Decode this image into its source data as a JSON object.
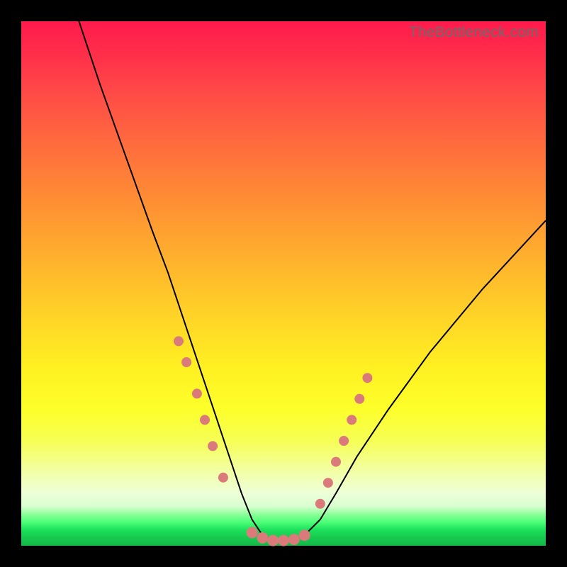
{
  "watermark": "TheBottleneck.com",
  "chart_data": {
    "type": "line",
    "title": "",
    "xlabel": "",
    "ylabel": "",
    "xlim": [
      0,
      100
    ],
    "ylim": [
      0,
      100
    ],
    "grid": false,
    "series": [
      {
        "name": "curve",
        "x": [
          11,
          15,
          20,
          25,
          28,
          30,
          32,
          34,
          36,
          38,
          40,
          42,
          44,
          46,
          48,
          50,
          52,
          54,
          57,
          60,
          64,
          70,
          78,
          88,
          100
        ],
        "y": [
          100,
          88,
          74,
          60,
          52,
          46,
          40,
          34,
          28,
          22,
          16,
          10,
          5,
          2,
          1,
          1,
          1,
          2,
          5,
          10,
          17,
          26,
          37,
          49,
          62
        ],
        "stroke": "#000000",
        "stroke_width": 2
      }
    ],
    "markers": [
      {
        "cluster": "left-descent",
        "color": "#db7a7a",
        "r": 7,
        "points_xy": [
          [
            30,
            39
          ],
          [
            31.5,
            35
          ],
          [
            33.5,
            29
          ],
          [
            35,
            24
          ],
          [
            36.5,
            19
          ],
          [
            38.5,
            13
          ]
        ]
      },
      {
        "cluster": "valley-floor",
        "color": "#db7a7a",
        "r": 8,
        "points_xy": [
          [
            44,
            2.5
          ],
          [
            46,
            1.5
          ],
          [
            48,
            1
          ],
          [
            50,
            1
          ],
          [
            52,
            1.2
          ],
          [
            54,
            2
          ]
        ]
      },
      {
        "cluster": "right-ascent",
        "color": "#db7a7a",
        "r": 7,
        "points_xy": [
          [
            57,
            8
          ],
          [
            58.5,
            12
          ],
          [
            60,
            16
          ],
          [
            61.5,
            20
          ],
          [
            63,
            24
          ],
          [
            64.5,
            28
          ],
          [
            66,
            32
          ]
        ]
      }
    ],
    "colors": {
      "gradient_top": "#ff1a4d",
      "gradient_mid": "#ffd028",
      "gradient_bottom": "#14b847",
      "marker": "#db7a7a",
      "curve": "#000000",
      "frame": "#000000"
    }
  }
}
